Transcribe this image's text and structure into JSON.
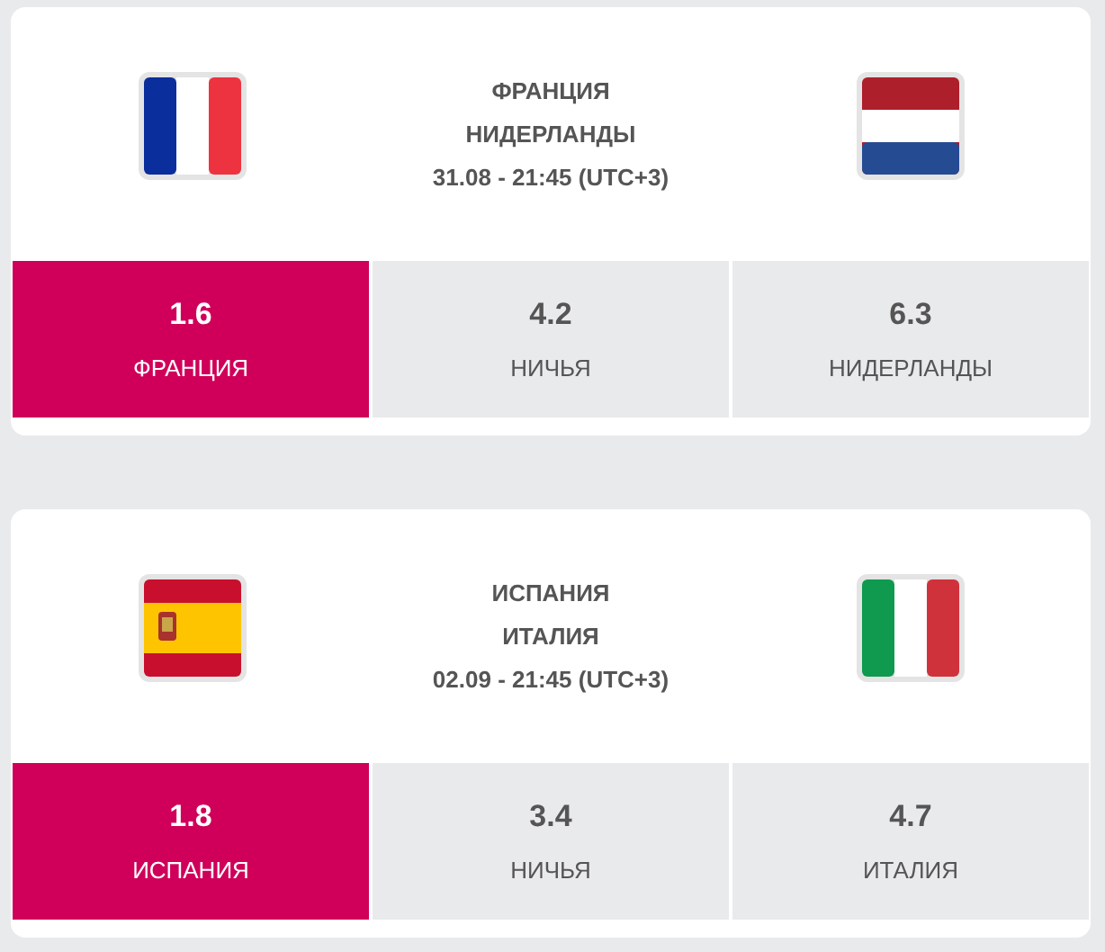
{
  "matches": [
    {
      "home": "ФРАНЦИЯ",
      "away": "НИДЕРЛАНДЫ",
      "time": "31.08 - 21:45 (UTC+3)",
      "odds": [
        {
          "value": "1.6",
          "label": "ФРАНЦИЯ",
          "selected": true
        },
        {
          "value": "4.2",
          "label": "НИЧЬЯ",
          "selected": false
        },
        {
          "value": "6.3",
          "label": "НИДЕРЛАНДЫ",
          "selected": false
        }
      ]
    },
    {
      "home": "ИСПАНИЯ",
      "away": "ИТАЛИЯ",
      "time": "02.09 - 21:45 (UTC+3)",
      "odds": [
        {
          "value": "1.8",
          "label": "ИСПАНИЯ",
          "selected": true
        },
        {
          "value": "3.4",
          "label": "НИЧЬЯ",
          "selected": false
        },
        {
          "value": "4.7",
          "label": "ИТАЛИЯ",
          "selected": false
        }
      ]
    }
  ]
}
